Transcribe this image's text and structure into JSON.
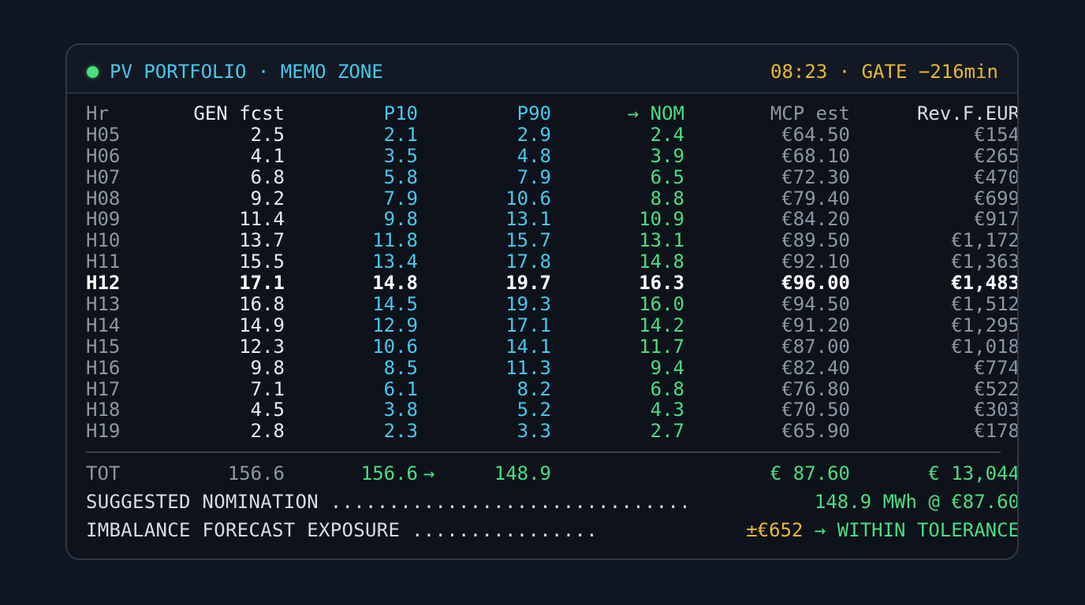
{
  "header": {
    "title": "PV PORTFOLIO · MEMO ZONE",
    "gate_status": "08:23 · GATE −216min",
    "accent_color": "#46c8ec",
    "status_color": "#4ade80",
    "warning_color": "#eab72e"
  },
  "table": {
    "columns": [
      "Hr",
      "GEN fcst",
      "P10",
      "P90",
      "→ NOM",
      "MCP est",
      "Rev.F.EUR"
    ],
    "highlight_hour": "H12",
    "rows": [
      [
        "H05",
        "2.5",
        "2.1",
        "2.9",
        "2.4",
        "€64.50",
        "€154"
      ],
      [
        "H06",
        "4.1",
        "3.5",
        "4.8",
        "3.9",
        "€68.10",
        "€265"
      ],
      [
        "H07",
        "6.8",
        "5.8",
        "7.9",
        "6.5",
        "€72.30",
        "€470"
      ],
      [
        "H08",
        "9.2",
        "7.9",
        "10.6",
        "8.8",
        "€79.40",
        "€699"
      ],
      [
        "H09",
        "11.4",
        "9.8",
        "13.1",
        "10.9",
        "€84.20",
        "€917"
      ],
      [
        "H10",
        "13.7",
        "11.8",
        "15.7",
        "13.1",
        "€89.50",
        "€1,172"
      ],
      [
        "H11",
        "15.5",
        "13.4",
        "17.8",
        "14.8",
        "€92.10",
        "€1,363"
      ],
      [
        "H12",
        "17.1",
        "14.8",
        "19.7",
        "16.3",
        "€96.00",
        "€1,483"
      ],
      [
        "H13",
        "16.8",
        "14.5",
        "19.3",
        "16.0",
        "€94.50",
        "€1,512"
      ],
      [
        "H14",
        "14.9",
        "12.9",
        "17.1",
        "14.2",
        "€91.20",
        "€1,295"
      ],
      [
        "H15",
        "12.3",
        "10.6",
        "14.1",
        "11.7",
        "€87.00",
        "€1,018"
      ],
      [
        "H16",
        "9.8",
        "8.5",
        "11.3",
        "9.4",
        "€82.40",
        "€774"
      ],
      [
        "H17",
        "7.1",
        "6.1",
        "8.2",
        "6.8",
        "€76.80",
        "€522"
      ],
      [
        "H18",
        "4.5",
        "3.8",
        "5.2",
        "4.3",
        "€70.50",
        "€303"
      ],
      [
        "H19",
        "2.8",
        "2.3",
        "3.3",
        "2.7",
        "€65.90",
        "€178"
      ]
    ]
  },
  "totals": {
    "label": "TOT",
    "gen": "156.6",
    "p10": "156.6",
    "arrow": "→",
    "p90": "148.9",
    "mcp": "€ 87.60",
    "rev": "€ 13,044"
  },
  "summary": {
    "nomination_label": "SUGGESTED NOMINATION ...............................",
    "nomination_value": "148.9 MWh @ €87.60",
    "exposure_label": "IMBALANCE FORECAST EXPOSURE ................",
    "exposure_amount": "±€652",
    "exposure_status": " → WITHIN TOLERANCE"
  }
}
